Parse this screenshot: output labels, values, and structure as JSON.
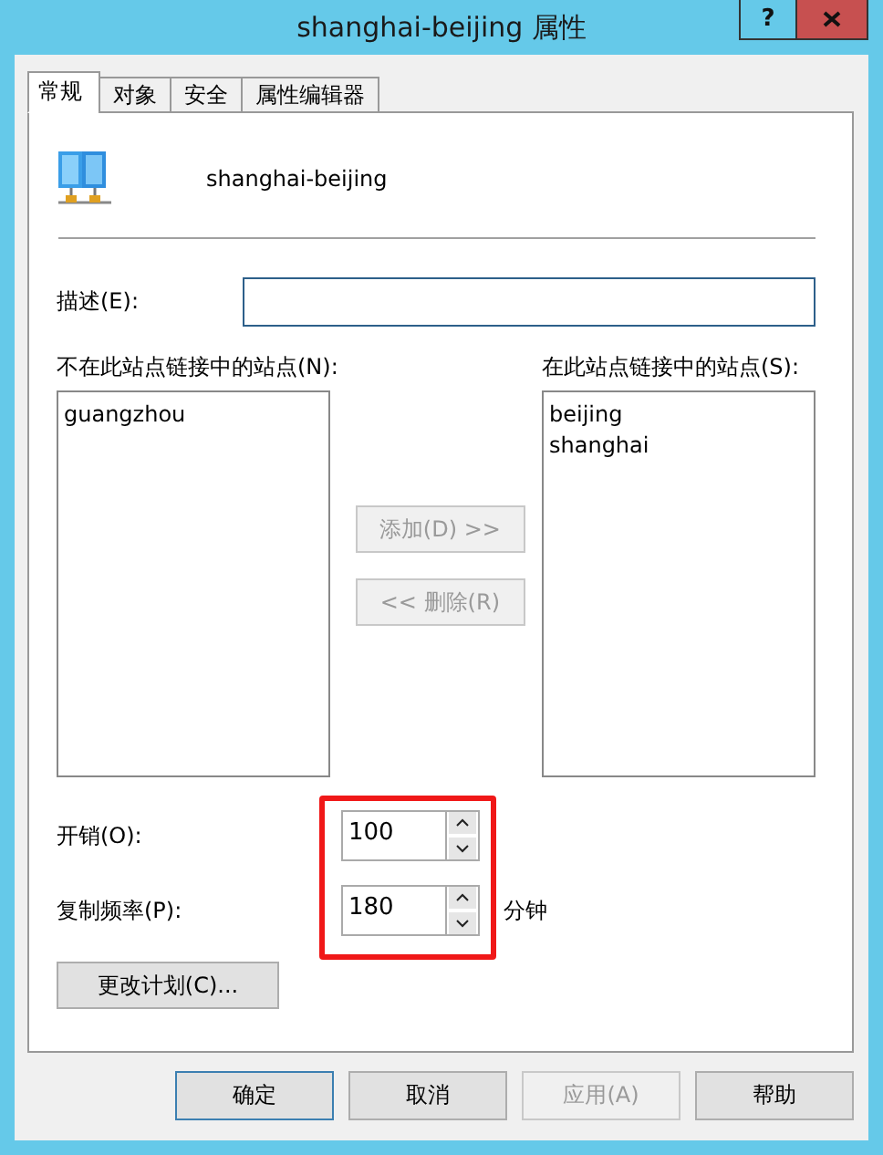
{
  "window": {
    "title": "shanghai-beijing 属性",
    "help_button": "?"
  },
  "tabs": [
    {
      "label": "常规",
      "selected": true
    },
    {
      "label": "对象",
      "selected": false
    },
    {
      "label": "安全",
      "selected": false
    },
    {
      "label": "属性编辑器",
      "selected": false
    }
  ],
  "header": {
    "name": "shanghai-beijing"
  },
  "description": {
    "label": "描述(E):"
  },
  "sites_not_in_link": {
    "label": "不在此站点链接中的站点(N):",
    "items": [
      "guangzhou"
    ]
  },
  "sites_in_link": {
    "label": "在此站点链接中的站点(S):",
    "items": [
      "beijing",
      "shanghai"
    ]
  },
  "move_buttons": [
    {
      "label": "添加(D) >>",
      "disabled": true
    },
    {
      "label": "<< 删除(R)",
      "disabled": true
    }
  ],
  "cost": {
    "label": "开销(O):",
    "value": "100"
  },
  "frequency": {
    "label": "复制频率(P):",
    "value": "180",
    "unit": "分钟"
  },
  "highlight": true,
  "schedule_button": "更改计划(C)...",
  "dialog_buttons": [
    {
      "label": "确定",
      "disabled": false,
      "default": true
    },
    {
      "label": "取消",
      "disabled": false,
      "default": false
    },
    {
      "label": "应用(A)",
      "disabled": true,
      "default": false
    },
    {
      "label": "帮助",
      "disabled": false,
      "default": false
    }
  ]
}
